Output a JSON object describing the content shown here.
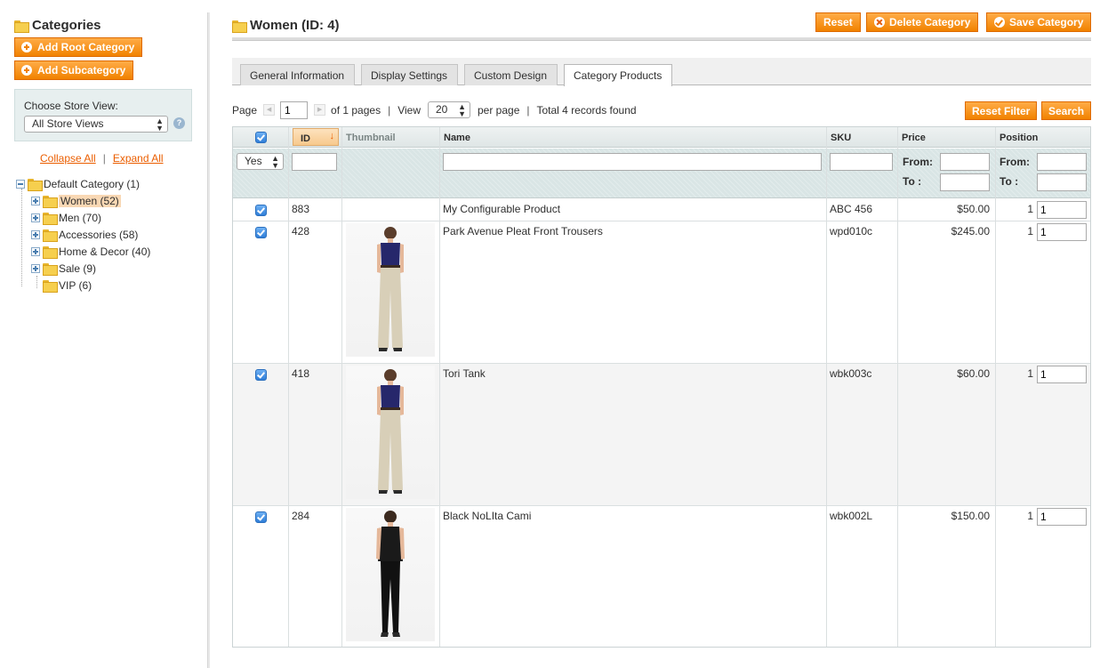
{
  "sidebar": {
    "title": "Categories",
    "add_root_label": "Add Root Category",
    "add_sub_label": "Add Subcategory",
    "store_view_label": "Choose Store View:",
    "store_view_value": "All Store Views",
    "help_glyph": "?",
    "collapse_all": "Collapse All",
    "expand_all": "Expand All",
    "link_sep": "|",
    "tree": [
      {
        "label": "Default Category (1)"
      },
      {
        "label": "Women (52)"
      },
      {
        "label": "Men (70)"
      },
      {
        "label": "Accessories (58)"
      },
      {
        "label": "Home & Decor (40)"
      },
      {
        "label": "Sale (9)"
      },
      {
        "label": "VIP (6)"
      }
    ]
  },
  "header": {
    "title": "Women (ID: 4)",
    "reset_label": "Reset",
    "delete_label": "Delete Category",
    "save_label": "Save Category"
  },
  "tabs": [
    {
      "label": "General Information"
    },
    {
      "label": "Display Settings"
    },
    {
      "label": "Custom Design"
    },
    {
      "label": "Category Products",
      "active": true
    }
  ],
  "pager": {
    "page_label": "Page",
    "page_value": "1",
    "of_pages": "of 1 pages",
    "sep": "|",
    "view_label": "View",
    "view_value": "20",
    "per_page": "per page",
    "total": "Total 4 records found",
    "reset_filter_label": "Reset Filter",
    "search_label": "Search"
  },
  "grid": {
    "columns": {
      "id": "ID",
      "thumbnail": "Thumbnail",
      "name": "Name",
      "sku": "SKU",
      "price": "Price",
      "position": "Position"
    },
    "sort_arrow": "↓",
    "filters": {
      "in_category": "Yes",
      "from_label": "From:",
      "to_label": "To :"
    },
    "rows": [
      {
        "id": "883",
        "name": "My Configurable Product",
        "sku": "ABC 456",
        "price": "$50.00",
        "position_text": "1",
        "position_value": "1"
      },
      {
        "id": "428",
        "name": "Park Avenue Pleat Front Trousers",
        "sku": "wpd010c",
        "price": "$245.00",
        "position_text": "1",
        "position_value": "1"
      },
      {
        "id": "418",
        "name": "Tori Tank",
        "sku": "wbk003c",
        "price": "$60.00",
        "position_text": "1",
        "position_value": "1"
      },
      {
        "id": "284",
        "name": "Black NoLIta Cami",
        "sku": "wbk002L",
        "price": "$150.00",
        "position_text": "1",
        "position_value": "1"
      }
    ]
  },
  "colors": {
    "accent": "#f18200",
    "link": "#eb5e00",
    "selected_node": "#f9d8b4"
  }
}
